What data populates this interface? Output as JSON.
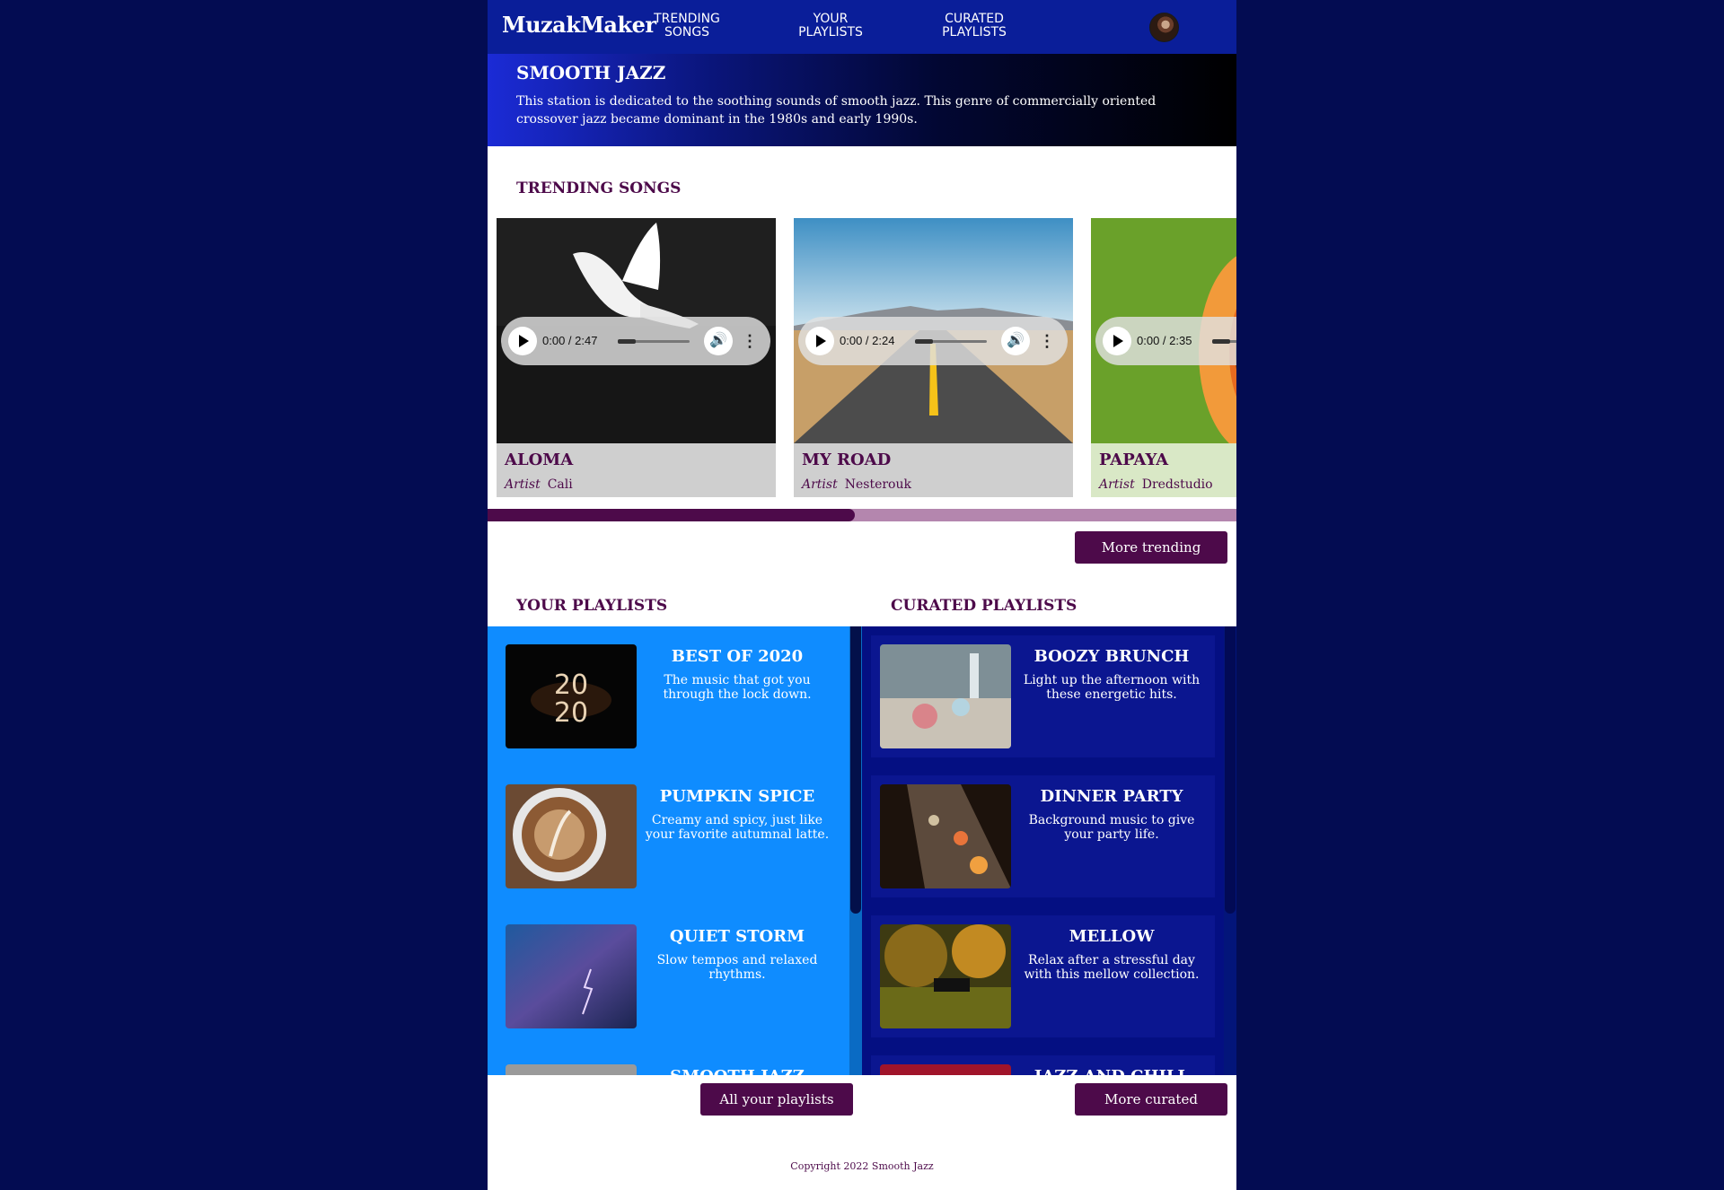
{
  "nav": {
    "logo": "MuzakMaker",
    "links": [
      "TRENDING SONGS",
      "YOUR PLAYLISTS",
      "CURATED PLAYLISTS"
    ]
  },
  "hero": {
    "title": "SMOOTH JAZZ",
    "description": "This station is dedicated to the soothing sounds of smooth jazz. This genre of commercially oriented crossover jazz became dominant in the 1980s and early 1990s."
  },
  "trending": {
    "heading": "TRENDING SONGS",
    "artist_label": "Artist",
    "more_button": "More trending",
    "scroll_position": 0.49,
    "songs": [
      {
        "title": "ALOMA",
        "artist": "Cali",
        "time": "0:00 / 2:47"
      },
      {
        "title": "MY ROAD",
        "artist": "Nesterouk",
        "time": "0:00 / 2:24"
      },
      {
        "title": "PAPAYA",
        "artist": "Dredstudio",
        "time": "0:00 / 2:35"
      }
    ]
  },
  "your_playlists": {
    "heading": "YOUR PLAYLISTS",
    "button": "All your playlists",
    "items": [
      {
        "title": "BEST OF 2020",
        "desc": "The music that got you through the lock down."
      },
      {
        "title": "PUMPKIN SPICE",
        "desc": "Creamy and spicy, just like your favorite autumnal latte."
      },
      {
        "title": "QUIET STORM",
        "desc": "Slow tempos and relaxed rhythms."
      },
      {
        "title": "SMOOTH JAZZ",
        "desc": ""
      }
    ]
  },
  "curated_playlists": {
    "heading": "CURATED PLAYLISTS",
    "button": "More curated",
    "items": [
      {
        "title": "BOOZY BRUNCH",
        "desc": "Light up the afternoon with these energetic hits."
      },
      {
        "title": "DINNER PARTY",
        "desc": "Background music to give your party life."
      },
      {
        "title": "MELLOW",
        "desc": "Relax after a stressful day with this mellow collection."
      },
      {
        "title": "JAZZ AND CHILL",
        "desc": ""
      }
    ]
  },
  "footer": {
    "copyright": "Copyright 2022 Smooth Jazz"
  },
  "colors": {
    "page_bg": "#030c52",
    "nav_bg": "#0a1e99",
    "accent": "#4d0a4a",
    "your_panel": "#0f8cff",
    "curated_panel": "#040f82"
  }
}
